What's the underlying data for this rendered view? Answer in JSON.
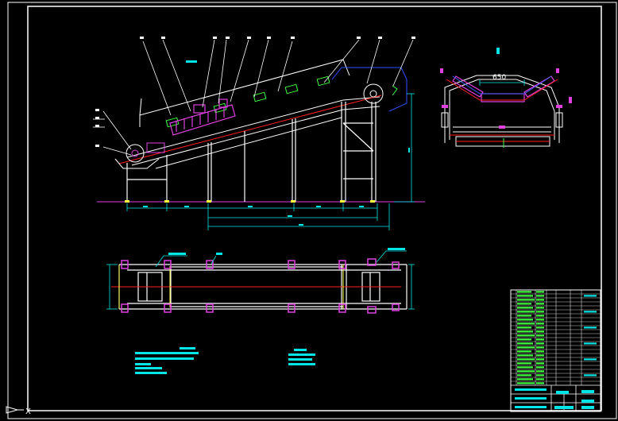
{
  "drawing": {
    "trough_width_label": "650",
    "corner_axis_label": "X"
  },
  "colors": {
    "background": "#000000",
    "frame": "#ffffff",
    "structure": "#ffffff",
    "center_line": "#ff2020",
    "dimension": "#00e5e5",
    "leader": "#ffffff",
    "hatch": "#e040e0",
    "text_green": "#40ff40",
    "idler_blue": "#4060ff",
    "hood": "#3050ff",
    "yellow": "#ffff40"
  },
  "icons": {
    "corner": "ucs-axis-icon"
  }
}
